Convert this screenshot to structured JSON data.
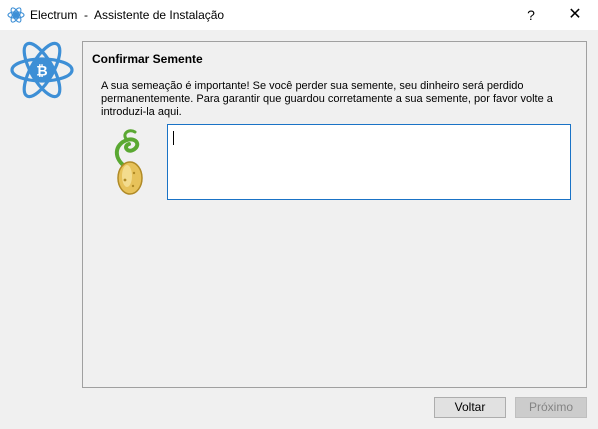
{
  "window": {
    "title": "Electrum  -  Assistente de Instalação",
    "help_label": "?",
    "close_label": "✕"
  },
  "panel": {
    "title": "Confirmar Semente",
    "message": "A sua semeação é importante! Se você perder sua semente, seu dinheiro será perdido permanentemente. Para garantir que guardou corretamente a sua semente, por favor volte a introduzi-la aqui.",
    "seed_value": ""
  },
  "buttons": {
    "back": "Voltar",
    "next": "Próximo"
  },
  "colors": {
    "electrum_blue": "#3d8fd6",
    "input_border": "#1a73c6",
    "disabled_text": "#838383"
  }
}
